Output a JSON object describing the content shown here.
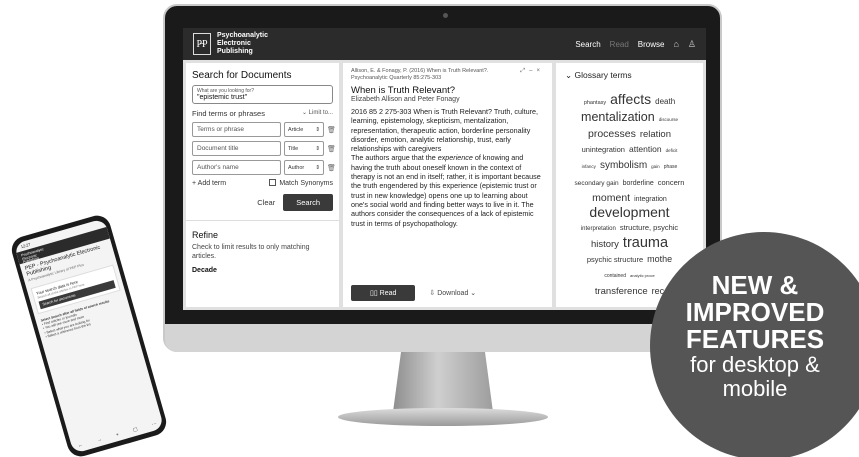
{
  "app": {
    "logo_mark": "P̶P",
    "logo_lines": [
      "Psychoanalytic",
      "Electronic",
      "Publishing"
    ],
    "nav": {
      "search": "Search",
      "read": "Read",
      "browse": "Browse"
    },
    "icons": {
      "home": "⌂",
      "user": "♙"
    }
  },
  "search_panel": {
    "heading": "Search for Documents",
    "query_caption": "What are you looking for?",
    "query_value": "\"epistemic trust\"",
    "find_terms": "Find terms or phrases",
    "limit_to": "⌄ Limit to...",
    "rows": [
      {
        "placeholder": "Terms or phrase",
        "select": "Article"
      },
      {
        "placeholder": "Document title",
        "select": "Title"
      },
      {
        "placeholder": "Author's name",
        "select": "Author"
      }
    ],
    "add_term": "+ Add term",
    "match_synonyms": "Match Synonyms",
    "clear": "Clear",
    "search": "Search"
  },
  "refine": {
    "heading": "Refine",
    "text": "Check to limit results to only matching articles.",
    "decade": "Decade"
  },
  "document": {
    "citation": "Allison, E. & Fonagy, P. (2016) When is Truth Relevant?. Psychoanalytic Quarterly 85:275-303",
    "title": "When is Truth Relevant?",
    "authors": "Elizabeth Allison and Peter Fonagy",
    "keywords": "2016 85 2 275-303 When is Truth Relevant? Truth, culture, learning, epistemology, skepticism, mentalization, representation, therapeutic action, borderline personality disorder, emotion, analytic relationship, trust, early relationships with caregivers",
    "abstract_lead": "The authors argue that the ",
    "abstract_em": "experience",
    "abstract_rest": " of knowing and having the truth about oneself known in the context of therapy is not an end in itself; rather, it is important because the truth engendered by this experience (epistemic trust or trust in new knowledge) opens one up to learning about one's social world and finding better ways to live in it. The authors consider the consequences of a lack of epistemic trust in terms of psychopathology.",
    "read": "Read",
    "download": "Download"
  },
  "glossary": {
    "heading": "Glossary terms",
    "lines": [
      [
        {
          "t": "phantasy",
          "s": 5.5
        },
        {
          "t": "affects",
          "s": 14
        },
        {
          "t": "death",
          "s": 8
        }
      ],
      [
        {
          "t": "mentalization",
          "s": 12.5
        },
        {
          "t": "discourse",
          "s": 4.5
        }
      ],
      [
        {
          "t": "processes",
          "s": 10.5
        },
        {
          "t": "relation",
          "s": 9.5
        }
      ],
      [
        {
          "t": "unintegration",
          "s": 7.5
        },
        {
          "t": "attention",
          "s": 8.5
        },
        {
          "t": "deficit",
          "s": 4.5
        }
      ],
      [
        {
          "t": "infancy",
          "s": 4.5
        },
        {
          "t": "symbolism",
          "s": 10
        },
        {
          "t": "gain",
          "s": 4.5
        },
        {
          "t": "phase",
          "s": 5
        }
      ],
      [
        {
          "t": "secondary gain",
          "s": 6.5
        },
        {
          "t": "borderline",
          "s": 7
        },
        {
          "t": "concern",
          "s": 7.5
        }
      ],
      [
        {
          "t": "moment",
          "s": 10.5
        },
        {
          "t": "integration",
          "s": 7
        }
      ],
      [
        {
          "t": "development",
          "s": 14
        }
      ],
      [
        {
          "t": "interpretation",
          "s": 6
        },
        {
          "t": "structure, psychic",
          "s": 7.5
        }
      ],
      [
        {
          "t": "history",
          "s": 9.5
        },
        {
          "t": "trauma",
          "s": 14.5
        }
      ],
      [
        {
          "t": "psychic structure",
          "s": 7.5
        },
        {
          "t": "mothe",
          "s": 9
        }
      ],
      [
        {
          "t": "contained",
          "s": 5
        },
        {
          "t": "analytic proce",
          "s": 4
        }
      ],
      [
        {
          "t": "transference",
          "s": 9.5
        },
        {
          "t": "rec",
          "s": 9
        }
      ]
    ]
  },
  "phone": {
    "time": "12:27",
    "header_lines": [
      "Psychoanalytic",
      "Electronic",
      "Publishing"
    ],
    "title": "PEP - Psychoanalytic Electronic Publishing",
    "subtitle": "A Psychoanalytic Library of PEP Plus",
    "card_title": "Your search data is here",
    "card_text": "Search all of the articles in PEP here",
    "card_button": "Search for documents",
    "list_heading": "Select Search after all fields of search results",
    "list_items": [
      "Find articles or journals",
      "You will see more and more",
      "Select what you are looking for",
      "Select a reference from the list"
    ]
  },
  "promo": {
    "line1": "NEW &",
    "line2": "IMPROVED",
    "line3": "FEATURES",
    "line4": "for desktop &",
    "line5": "mobile"
  }
}
